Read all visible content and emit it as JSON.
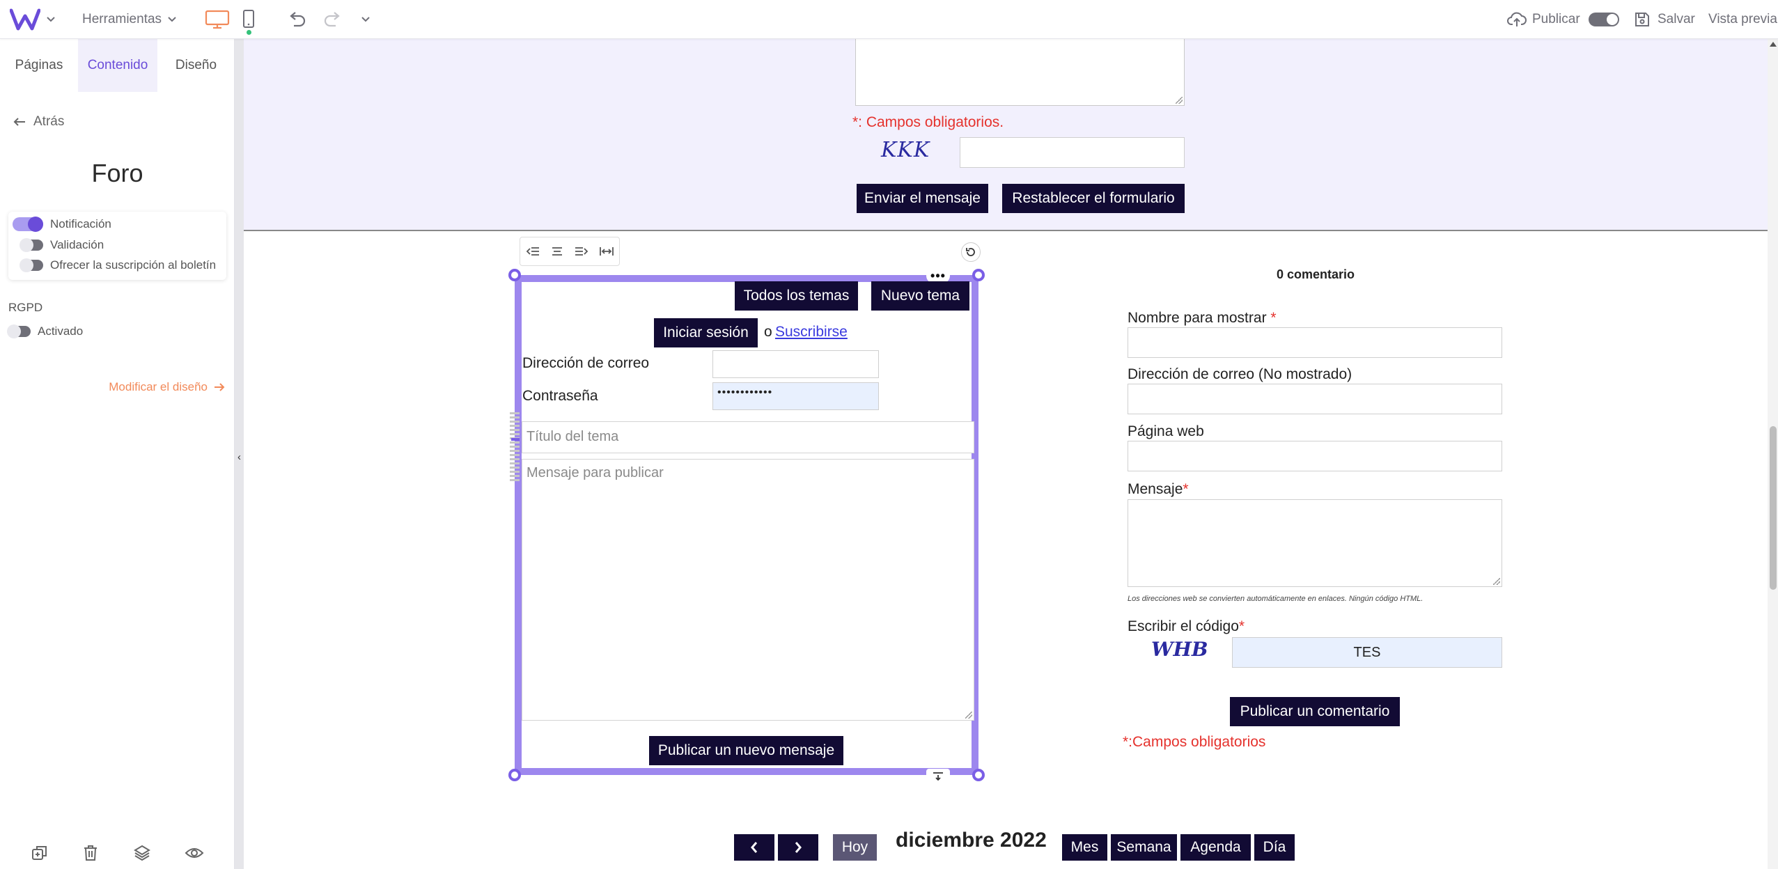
{
  "toolbar": {
    "tools_label": "Herramientas",
    "publish_label": "Publicar",
    "save_label": "Salvar",
    "preview_label": "Vista previa"
  },
  "sidebar": {
    "tabs": [
      {
        "label": "Páginas"
      },
      {
        "label": "Contenido"
      },
      {
        "label": "Diseño"
      }
    ],
    "back_label": "Atrás",
    "panel_title": "Foro",
    "options": [
      {
        "label": "Notificación",
        "on": true
      },
      {
        "label": "Validación",
        "on": false
      },
      {
        "label": "Ofrecer la suscripción al boletín",
        "on": false
      }
    ],
    "gdpr_label": "RGPD",
    "gdpr_option": {
      "label": "Activado",
      "on": false
    },
    "modify_design_label": "Modificar el diseño"
  },
  "top_form": {
    "required_note": "*: Campos obligatorios.",
    "captcha_text": "KKK",
    "send_button": "Enviar el mensaje",
    "reset_button": "Restablecer el formulario"
  },
  "forum": {
    "all_topics_button": "Todos los temas",
    "new_topic_button": "Nuevo tema",
    "login_button": "Iniciar sesión",
    "or_text": "o",
    "subscribe_link": "Suscribirse",
    "email_label": "Dirección de correo",
    "password_label": "Contraseña",
    "password_value": "••••••••••••",
    "topic_placeholder": "Título del tema",
    "message_placeholder": "Mensaje para publicar",
    "publish_button": "Publicar un nuevo mensaje"
  },
  "comments": {
    "count_label": "0 comentario",
    "display_name_label": "Nombre para mostrar",
    "email_label": "Dirección de correo (No mostrado)",
    "website_label": "Página web",
    "message_label": "Mensaje",
    "hint": "Los direcciones web se convierten automáticamente en enlaces. Ningún código HTML.",
    "captcha_label": "Escribir el código",
    "captcha_text": "WHB",
    "captcha_value": "TES",
    "submit_button": "Publicar un comentario",
    "required_note": "*:Campos obligatorios",
    "required_mark": "*"
  },
  "calendar": {
    "prev_label": "‹",
    "next_label": "›",
    "today_label": "Hoy",
    "title": "diciembre 2022",
    "views": [
      "Mes",
      "Semana",
      "Agenda",
      "Día"
    ]
  },
  "colors": {
    "accent": "#6a4cd9",
    "selection": "#9d87ee",
    "dark_button": "#120b34",
    "required": "#e5322d",
    "band": "#f2f0fd"
  }
}
